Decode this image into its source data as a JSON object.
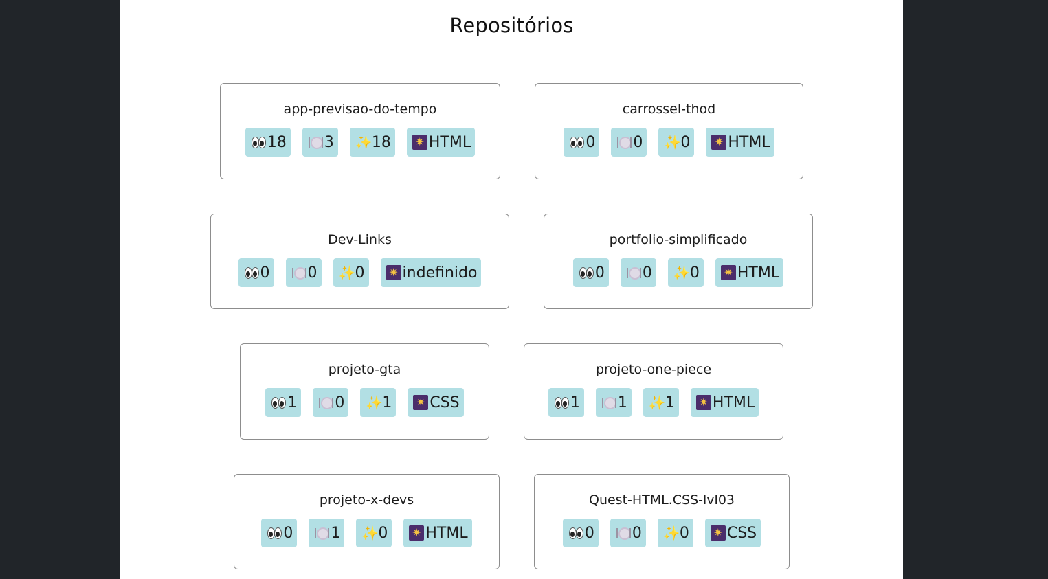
{
  "page": {
    "title": "Repositórios"
  },
  "icons": {
    "watchers": "eyes-icon",
    "forks": "plate-icon",
    "stars": "sparkles-icon",
    "language": "starburst-icon"
  },
  "colors": {
    "background": "#212529",
    "page": "#ffffff",
    "badge": "#b2dfe4",
    "card_border": "#8d8d8d"
  },
  "repos": [
    {
      "name": "app-previsao-do-tempo",
      "watchers": "18",
      "forks": "3",
      "stars": "18",
      "language": "HTML"
    },
    {
      "name": "carrossel-thod",
      "watchers": "0",
      "forks": "0",
      "stars": "0",
      "language": "HTML"
    },
    {
      "name": "Dev-Links",
      "watchers": "0",
      "forks": "0",
      "stars": "0",
      "language": "indefinido"
    },
    {
      "name": "portfolio-simplificado",
      "watchers": "0",
      "forks": "0",
      "stars": "0",
      "language": "HTML"
    },
    {
      "name": "projeto-gta",
      "watchers": "1",
      "forks": "0",
      "stars": "1",
      "language": "CSS"
    },
    {
      "name": "projeto-one-piece",
      "watchers": "1",
      "forks": "1",
      "stars": "1",
      "language": "HTML"
    },
    {
      "name": "projeto-x-devs",
      "watchers": "0",
      "forks": "1",
      "stars": "0",
      "language": "HTML"
    },
    {
      "name": "Quest-HTML.CSS-lvl03",
      "watchers": "0",
      "forks": "0",
      "stars": "0",
      "language": "CSS"
    }
  ]
}
